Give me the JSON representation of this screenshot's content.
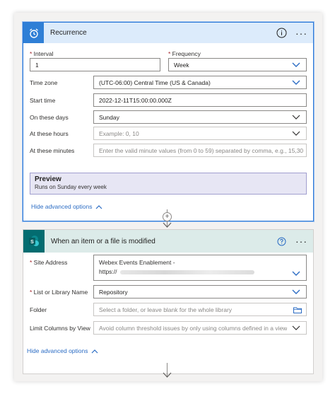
{
  "recurrence": {
    "title": "Recurrence",
    "interval_label": "Interval",
    "interval_value": "1",
    "frequency_label": "Frequency",
    "frequency_value": "Week",
    "timezone_label": "Time zone",
    "timezone_value": "(UTC-06:00) Central Time (US & Canada)",
    "start_label": "Start time",
    "start_value": "2022-12-11T15:00:00.000Z",
    "days_label": "On these days",
    "days_value": "Sunday",
    "hours_label": "At these hours",
    "hours_placeholder": "Example: 0, 10",
    "minutes_label": "At these minutes",
    "minutes_placeholder": "Enter the valid minute values (from 0 to 59) separated by comma, e.g., 15,30",
    "preview_title": "Preview",
    "preview_text": "Runs on Sunday every week",
    "hide_advanced": "Hide advanced options"
  },
  "connector": {
    "plus": "+"
  },
  "sharepoint": {
    "title": "When an item or a file is modified",
    "site_label": "Site Address",
    "site_value_line1": "Webex Events Enablement -",
    "site_value_line2": "https://",
    "list_label": "List or Library Name",
    "list_value": "Repository",
    "folder_label": "Folder",
    "folder_placeholder": "Select a folder, or leave blank for the whole library",
    "columns_label": "Limit Columns by View",
    "columns_placeholder": "Avoid column threshold issues by only using columns defined in a view",
    "hide_advanced": "Hide advanced options"
  },
  "colors": {
    "accent": "#2b78d6",
    "recurrence_icon_bg": "#2f7fd6",
    "sharepoint_icon_bg": "#036c70",
    "link": "#2b6cc4",
    "required": "#a4262c"
  }
}
